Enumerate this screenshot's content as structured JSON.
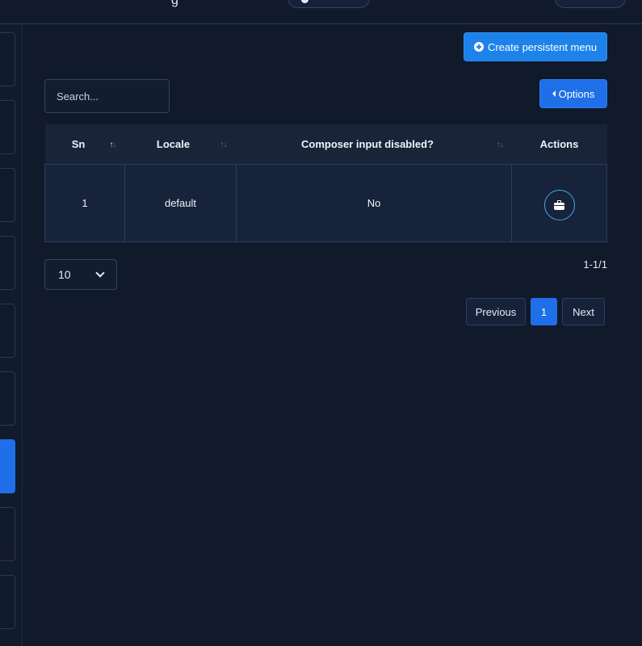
{
  "header": {
    "title_fragment": "g"
  },
  "sidebar": {
    "items": [
      {
        "active": false
      },
      {
        "active": false
      },
      {
        "active": false
      },
      {
        "active": false
      },
      {
        "active": false
      },
      {
        "active": false
      },
      {
        "active": true
      },
      {
        "active": false
      },
      {
        "active": false
      }
    ]
  },
  "toolbar": {
    "create_label": "Create persistent menu",
    "options_label": "Options"
  },
  "search": {
    "placeholder": "Search..."
  },
  "table": {
    "columns": [
      "Sn",
      "Locale",
      "Composer input disabled?",
      "Actions"
    ],
    "rows": [
      {
        "sn": "1",
        "locale": "default",
        "composer_input_disabled": "No"
      }
    ]
  },
  "pagination": {
    "page_size": "10",
    "range_text": "1-1/1",
    "previous_label": "Previous",
    "current_page": "1",
    "next_label": "Next"
  },
  "colors": {
    "background": "#111a2b",
    "primary": "#1e6fe8",
    "create_button": "#1d82ea"
  }
}
